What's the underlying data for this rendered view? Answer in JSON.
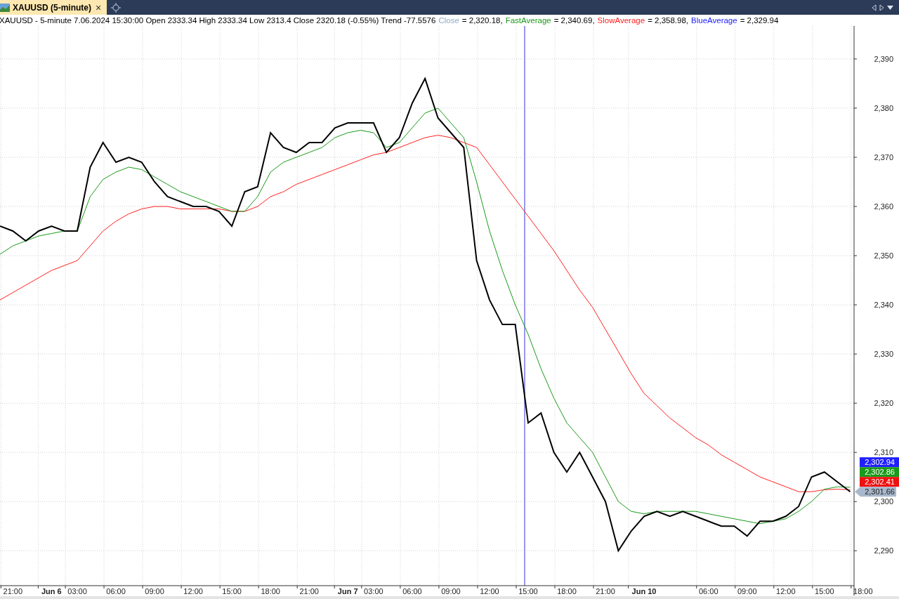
{
  "tabs": [
    {
      "label": "XAUUSD (5-minute)",
      "selected": true,
      "close": "×"
    }
  ],
  "legend": {
    "header": "XAUUSD - 5-minute 7.06.2024 15:30:00 Open 2333.34 High 2333.34 Low 2313.4 Close 2320.18 (-0.55%) Trend -77.5576",
    "items": [
      {
        "name": "Close",
        "color": "#8fa8c8",
        "value": "= 2,320.18,"
      },
      {
        "name": "FastAverage",
        "color": "#1a9a1a",
        "value": "= 2,340.69,"
      },
      {
        "name": "SlowAverage",
        "color": "#ff2020",
        "value": "= 2,358.98,"
      },
      {
        "name": "BlueAverage",
        "color": "#2020ff",
        "value": "= 2,329.94"
      }
    ]
  },
  "cursor_line": true,
  "chart_data": {
    "type": "line",
    "ylim": [
      2282.9,
      2396.7
    ],
    "categories": [
      null,
      "21:00",
      null,
      null,
      "Jun 6",
      null,
      "03:00",
      null,
      null,
      "06:00",
      null,
      null,
      "09:00",
      null,
      null,
      "12:00",
      null,
      null,
      "15:00",
      null,
      null,
      "18:00",
      null,
      null,
      "21:00",
      null,
      null,
      "Jun 7",
      null,
      "03:00",
      null,
      null,
      "06:00",
      null,
      null,
      "09:00",
      null,
      null,
      "12:00",
      null,
      null,
      "15:00",
      null,
      null,
      "18:00",
      null,
      null,
      "21:00",
      null,
      null,
      "Jun 10",
      null,
      null,
      null,
      null,
      "06:00",
      null,
      null,
      "09:00",
      null,
      null,
      "12:00",
      null,
      null,
      "15:00",
      null,
      null,
      "18:00"
    ],
    "series": [
      {
        "color": "#000000",
        "values": [
          2356,
          2355,
          2353,
          2355,
          2356,
          2355,
          2355,
          2368,
          2373,
          2369,
          2370,
          2369,
          2365,
          2362,
          2361,
          2360,
          2360,
          2359,
          2356,
          2363,
          2364,
          2375,
          2372,
          2371,
          2373,
          2373,
          2376,
          2377,
          2377,
          2377,
          2371,
          2374,
          2381,
          2386,
          2378,
          2375,
          2372,
          2349,
          2341,
          2336,
          2336,
          2316,
          2318,
          2310,
          2306,
          2310,
          2305,
          2300,
          2290,
          2294,
          2297,
          2298,
          2297,
          2298,
          2297,
          2296,
          2295,
          2295,
          2293,
          2296,
          2296,
          2297,
          2299,
          2305,
          2306,
          2304,
          2302,
          null
        ]
      },
      {
        "color": "#1a9a1a",
        "values": [
          2350.3,
          2352,
          2353,
          2354,
          2354.5,
          2355,
          2355,
          2362,
          2365.5,
          2367,
          2368,
          2367.5,
          2366,
          2364.5,
          2363,
          2362,
          2361,
          2360,
          2359,
          2359,
          2362,
          2367,
          2369,
          2370,
          2371,
          2372,
          2374,
          2375,
          2375.5,
          2375,
          2372,
          2373,
          2376,
          2379,
          2380,
          2377,
          2374,
          2365,
          2355,
          2347,
          2340,
          2334,
          2327,
          2321,
          2316,
          2313,
          2310,
          2305,
          2300,
          2298,
          2297.5,
          2298,
          2298,
          2298,
          2298,
          2297.5,
          2297,
          2296.5,
          2296,
          2295.5,
          2296,
          2296.5,
          2298,
          2300,
          2302.5,
          2303,
          2302.9,
          null
        ]
      },
      {
        "color": "#ff2020",
        "values": [
          2341,
          2342.5,
          2344,
          2345.5,
          2347,
          2348,
          2349,
          2352,
          2355,
          2357,
          2358.5,
          2359.5,
          2360,
          2360,
          2359.5,
          2359.5,
          2359.5,
          2359.5,
          2359,
          2359,
          2360,
          2362,
          2363,
          2364.5,
          2365.5,
          2366.5,
          2367.5,
          2368.5,
          2369.5,
          2370.5,
          2371,
          2372,
          2373,
          2374,
          2374.5,
          2374,
          2373,
          2372,
          2368.5,
          2365,
          2361.5,
          2358,
          2354.5,
          2351,
          2347,
          2343,
          2339.5,
          2335,
          2330.5,
          2326,
          2322,
          2319.5,
          2317,
          2315,
          2313,
          2311.5,
          2309.5,
          2308,
          2306.5,
          2305,
          2304,
          2303,
          2302,
          2302,
          2302.4,
          2302.5,
          2302.4,
          null
        ]
      }
    ],
    "grid": true,
    "yticks": [
      {
        "value": 2290,
        "label": "2,290"
      },
      {
        "value": 2300,
        "label": "2,300"
      },
      {
        "value": 2310,
        "label": "2,310"
      },
      {
        "value": 2320,
        "label": "2,320"
      },
      {
        "value": 2330,
        "label": "2,330"
      },
      {
        "value": 2340,
        "label": "2,340"
      },
      {
        "value": 2350,
        "label": "2,350"
      },
      {
        "value": 2360,
        "label": "2,360"
      },
      {
        "value": 2370,
        "label": "2,370"
      },
      {
        "value": 2380,
        "label": "2,380"
      },
      {
        "value": 2390,
        "label": "2,390"
      }
    ]
  },
  "price_tags": [
    {
      "label": "2,302.94",
      "color": "#2020ff",
      "kind": "box"
    },
    {
      "label": "2,302.86",
      "color": "#1a9a1a",
      "kind": "box"
    },
    {
      "label": "2,302.41",
      "color": "#ee1111",
      "kind": "box"
    },
    {
      "label": "2,301.66",
      "color": "#a8b8cc",
      "kind": "arrow"
    }
  ]
}
